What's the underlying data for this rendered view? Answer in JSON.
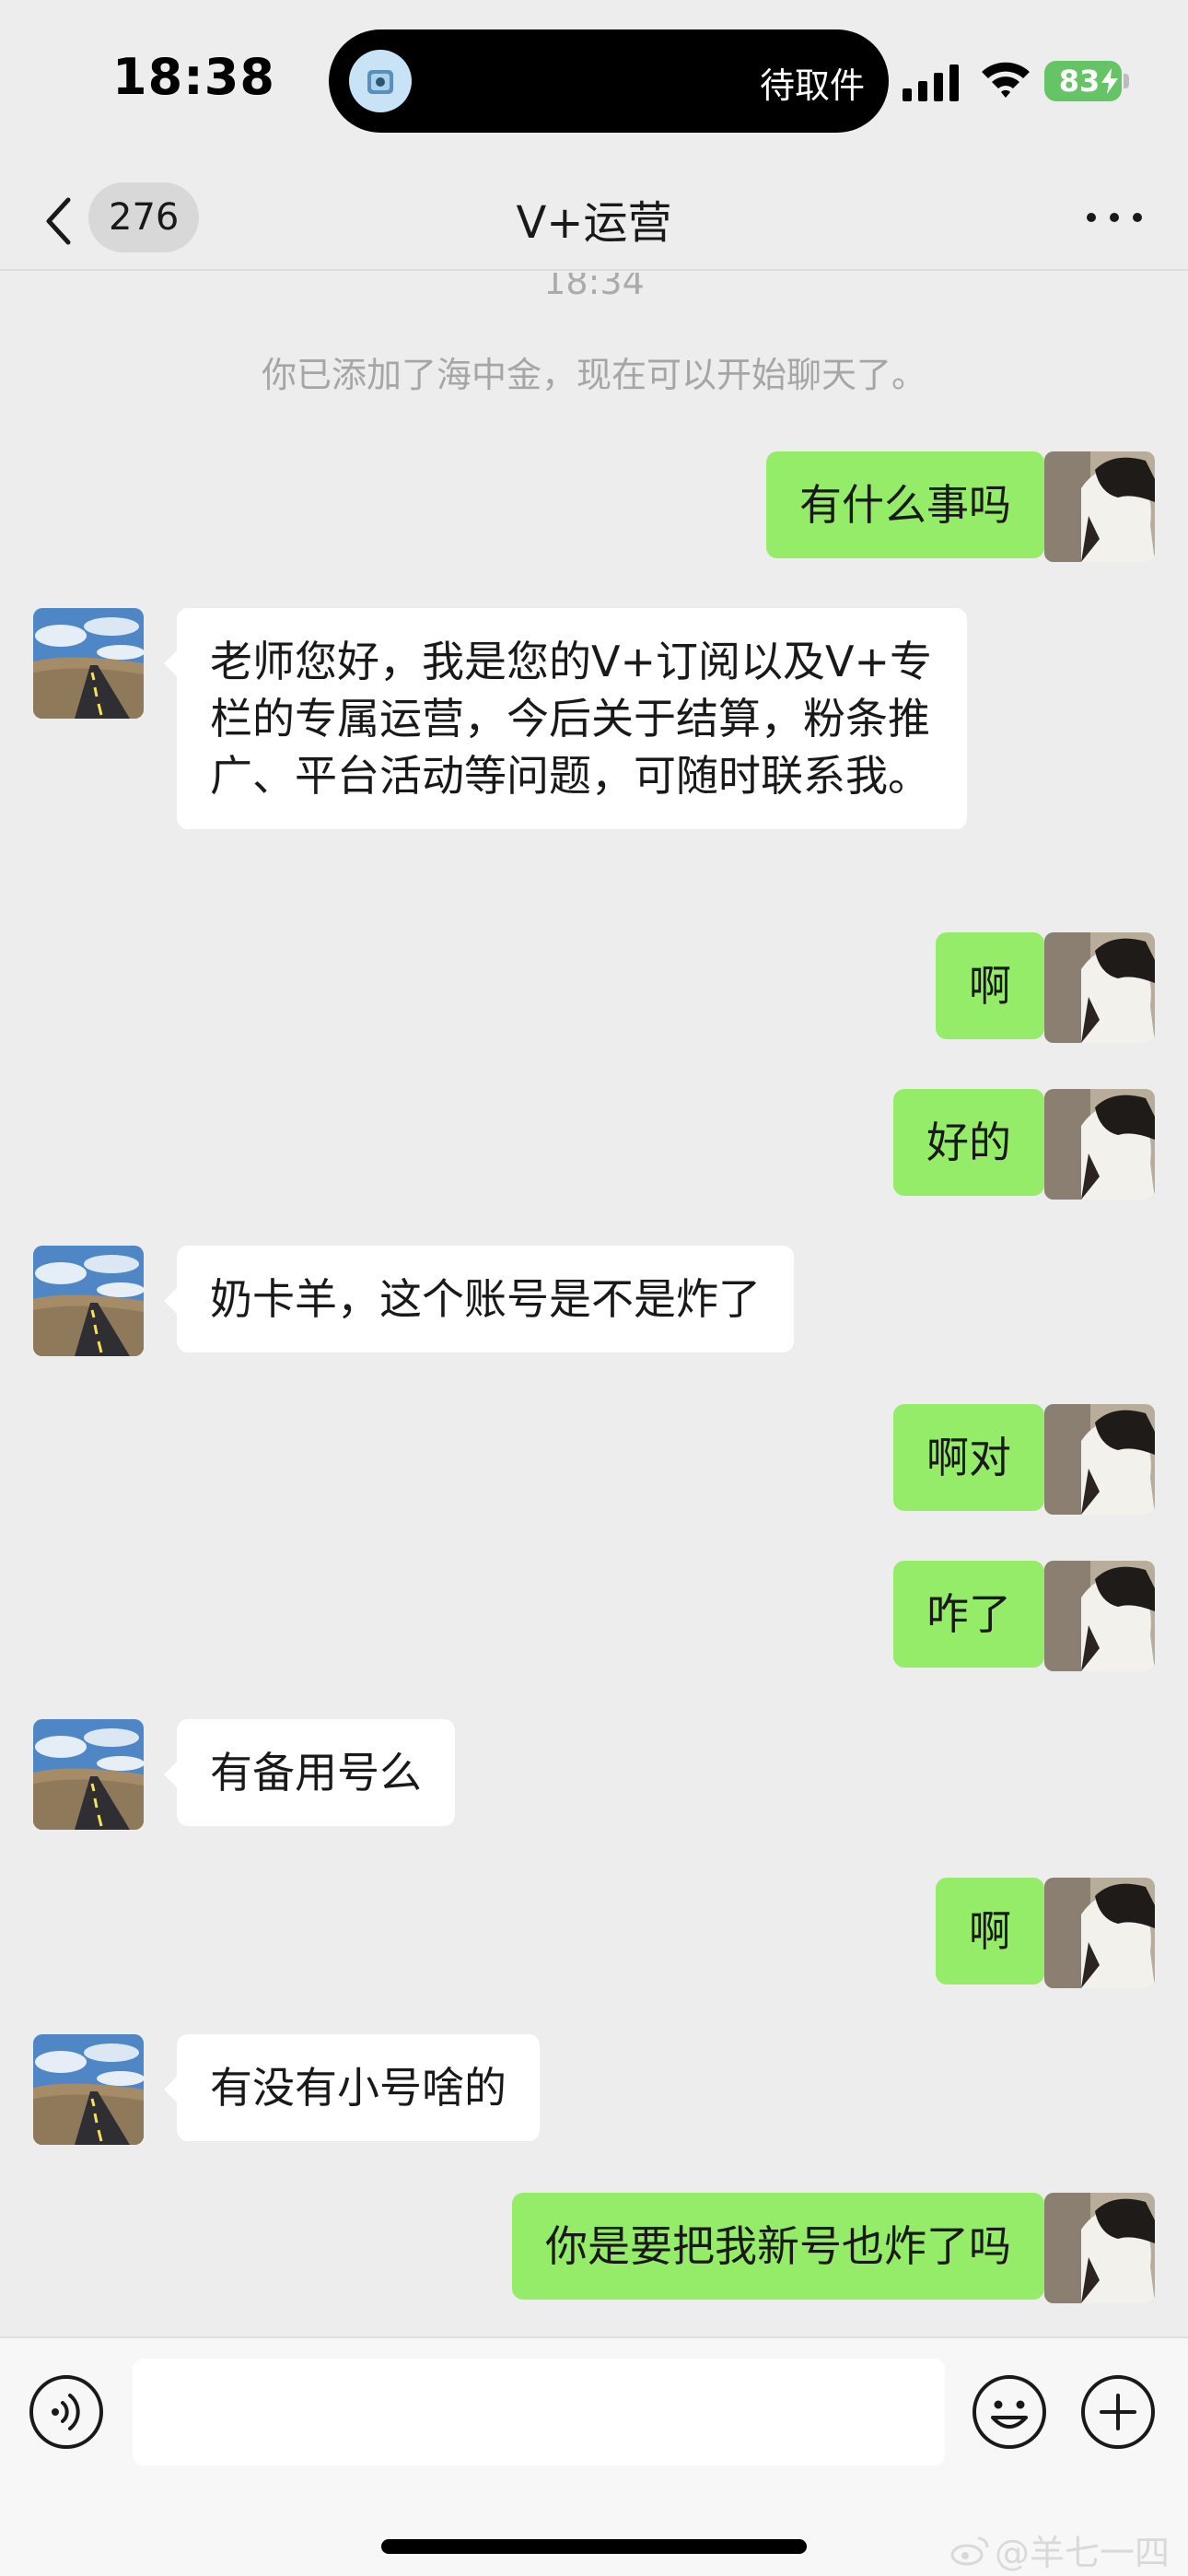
{
  "status_bar": {
    "time": "18:38",
    "island_text": "待取件",
    "battery": "83"
  },
  "nav": {
    "unread_count": "276",
    "title": "V+运营"
  },
  "chat": {
    "timestamp": "18:34",
    "system_notice": "你已添加了海中金，现在可以开始聊天了。",
    "messages": [
      {
        "side": "right",
        "text": "有什么事吗"
      },
      {
        "side": "left",
        "text": "老师您好，我是您的V+订阅以及V+专栏的专属运营，今后关于结算，粉条推广、平台活动等问题，可随时联系我。"
      },
      {
        "side": "right",
        "text": "啊"
      },
      {
        "side": "right",
        "text": "好的"
      },
      {
        "side": "left",
        "text": "奶卡羊，这个账号是不是炸了"
      },
      {
        "side": "right",
        "text": "啊对"
      },
      {
        "side": "right",
        "text": "咋了"
      },
      {
        "side": "left",
        "text": "有备用号么"
      },
      {
        "side": "right",
        "text": "啊"
      },
      {
        "side": "left",
        "text": "有没有小号啥的"
      },
      {
        "side": "right",
        "text": "你是要把我新号也炸了吗"
      }
    ]
  },
  "watermark": "@羊七一四",
  "icons": {
    "voice": "voice-icon",
    "emoji": "emoji-icon",
    "plus": "plus-icon",
    "back": "chevron-left-icon",
    "more": "more-icon"
  },
  "colors": {
    "sent_bubble": "#95ec69",
    "received_bubble": "#ffffff",
    "background": "#ededed"
  }
}
